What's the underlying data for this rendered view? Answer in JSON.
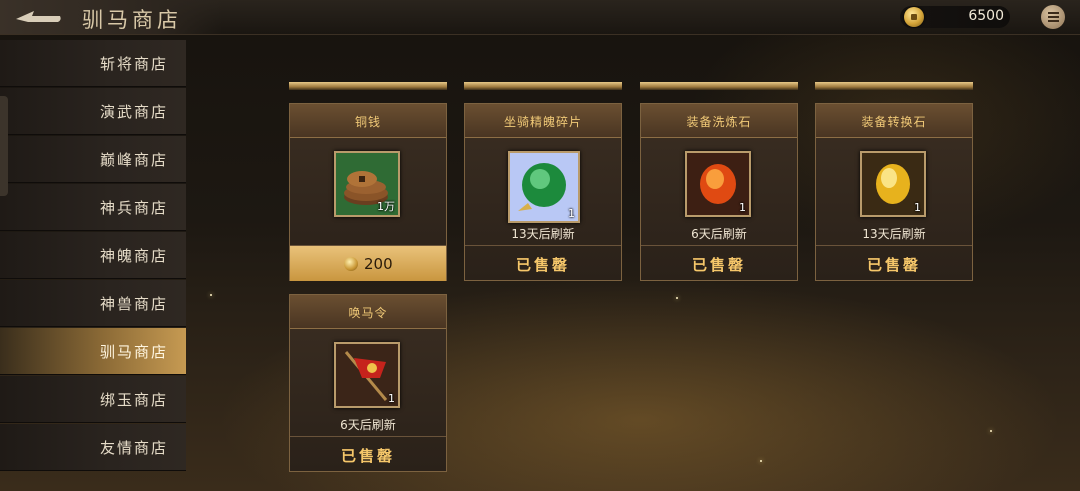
{
  "header": {
    "title": "驯马商店",
    "coin_amount": "6500",
    "icons": {
      "back": "back-arrow-icon",
      "coin": "gold-coin-icon",
      "menu": "menu-list-icon"
    }
  },
  "sidebar": {
    "items": [
      {
        "label": "斩将商店",
        "active": false
      },
      {
        "label": "演武商店",
        "active": false
      },
      {
        "label": "巅峰商店",
        "active": false
      },
      {
        "label": "神兵商店",
        "active": false
      },
      {
        "label": "神魄商店",
        "active": false
      },
      {
        "label": "神兽商店",
        "active": false
      },
      {
        "label": "驯马商店",
        "active": true
      },
      {
        "label": "绑玉商店",
        "active": false
      },
      {
        "label": "友情商店",
        "active": false
      }
    ]
  },
  "shop": {
    "items": [
      {
        "name": "铜钱",
        "qty": "1万",
        "icon": "copper-coins-icon",
        "price": "200",
        "status": "",
        "refresh": ""
      },
      {
        "name": "坐骑精魄碎片",
        "qty": "1",
        "icon": "green-orb-icon",
        "refresh": "13天后刷新",
        "status": "已售罄"
      },
      {
        "name": "装备洗炼石",
        "qty": "1",
        "icon": "red-stone-icon",
        "refresh": "6天后刷新",
        "status": "已售罄"
      },
      {
        "name": "装备转换石",
        "qty": "1",
        "icon": "yellow-stone-icon",
        "refresh": "13天后刷新",
        "status": "已售罄"
      },
      {
        "name": "唤马令",
        "qty": "1",
        "icon": "red-banner-icon",
        "refresh": "6天后刷新",
        "status": "已售罄"
      }
    ]
  },
  "colors": {
    "accent_gold": "#f6c76a",
    "active_tab": "#c69a52"
  }
}
